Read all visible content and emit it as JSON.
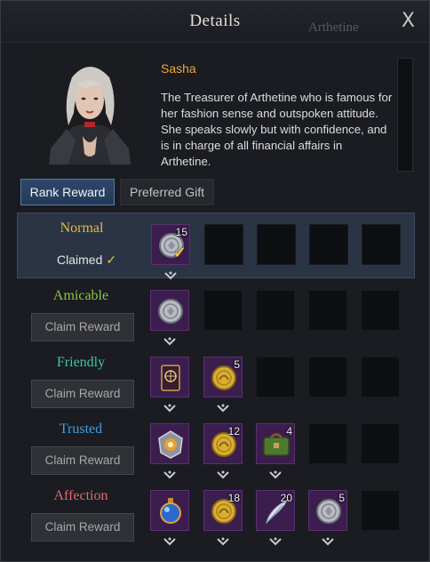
{
  "window": {
    "title": "Details",
    "background_label": "Arthetine",
    "close_label": "X"
  },
  "npc": {
    "name": "Sasha",
    "description": "The Treasurer of Arthetine who is famous for her fashion sense and outspoken attitude. She speaks slowly but with confidence, and is in charge of all financial affairs in Arthetine."
  },
  "tabs": {
    "rank_reward": "Rank Reward",
    "preferred_gift": "Preferred Gift"
  },
  "colors": {
    "normal": "#e7b84a",
    "amicable": "#8cc63f",
    "friendly": "#3fc6a8",
    "trusted": "#3f9fe0",
    "affection": "#e06a6a",
    "gold": "#e7a73a"
  },
  "rows": [
    {
      "tier": "Normal",
      "status": "Claimed",
      "items": [
        {
          "icon": "silver-coin-icon",
          "qty": "15",
          "claimed": true
        }
      ]
    },
    {
      "tier": "Amicable",
      "button": "Claim Reward",
      "items": [
        {
          "icon": "silver-coin-icon",
          "qty": ""
        }
      ]
    },
    {
      "tier": "Friendly",
      "button": "Claim Reward",
      "items": [
        {
          "icon": "card-icon",
          "qty": ""
        },
        {
          "icon": "gold-coin-icon",
          "qty": "5"
        }
      ]
    },
    {
      "tier": "Trusted",
      "button": "Claim Reward",
      "items": [
        {
          "icon": "emblem-icon",
          "qty": ""
        },
        {
          "icon": "gold-coin-icon",
          "qty": "12"
        },
        {
          "icon": "bag-icon",
          "qty": "4"
        }
      ]
    },
    {
      "tier": "Affection",
      "button": "Claim Reward",
      "items": [
        {
          "icon": "potion-icon",
          "qty": ""
        },
        {
          "icon": "gold-coin-icon",
          "qty": "18"
        },
        {
          "icon": "feather-icon",
          "qty": "20"
        },
        {
          "icon": "silver-coin-icon",
          "qty": "5"
        }
      ]
    }
  ]
}
